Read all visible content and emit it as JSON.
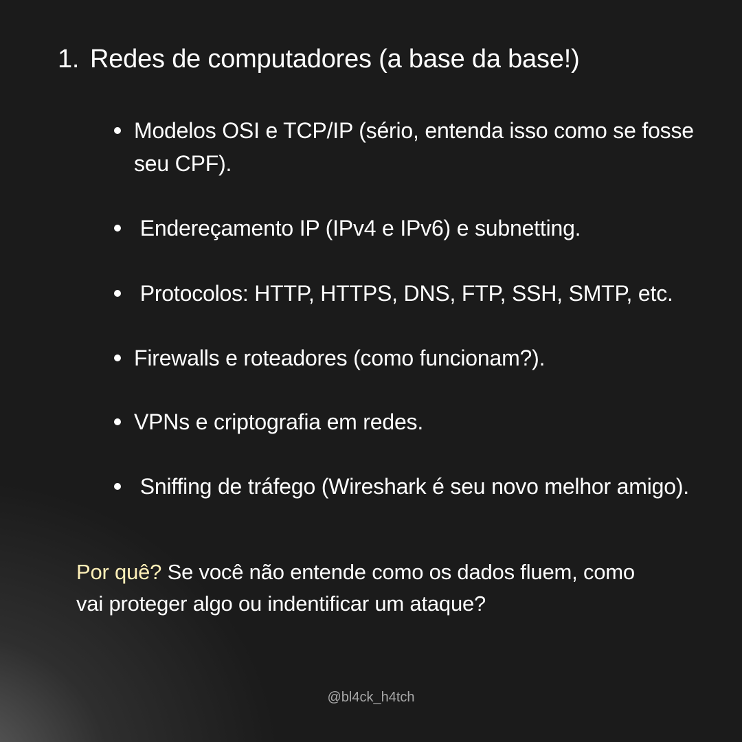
{
  "heading": {
    "number": "1.",
    "title": "Redes de computadores (a base da base!)"
  },
  "bullets": [
    {
      "text": "Modelos OSI e TCP/IP (sério, entenda isso como se fosse seu CPF)."
    },
    {
      "text": " Endereçamento IP (IPv4 e IPv6) e subnetting."
    },
    {
      "text": " Protocolos: HTTP, HTTPS, DNS, FTP, SSH, SMTP, etc."
    },
    {
      "text": "Firewalls e roteadores (como funcionam?)."
    },
    {
      "text": "VPNs e criptografia em redes."
    },
    {
      "text": " Sniffing de tráfego (Wireshark é seu novo melhor amigo)."
    }
  ],
  "why": {
    "lead": "Por quê?",
    "text": " Se você não entende como os dados fluem, como vai proteger algo ou indentificar um ataque?"
  },
  "handle": "@bl4ck_h4tch",
  "colors": {
    "background": "#1b1b1b",
    "text": "#ffffff",
    "highlight": "#fff0b8",
    "handle": "#a8a8a8"
  }
}
